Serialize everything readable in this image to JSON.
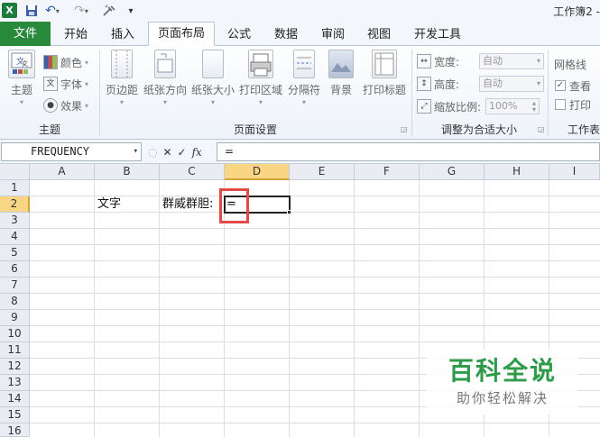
{
  "window": {
    "title": "工作簿2 -"
  },
  "qat": {
    "app_icon": "X",
    "save": "💾",
    "undo": "↶",
    "redo": "↷",
    "more": "▾"
  },
  "tabs": [
    {
      "label": "文件"
    },
    {
      "label": "开始"
    },
    {
      "label": "插入"
    },
    {
      "label": "页面布局"
    },
    {
      "label": "公式"
    },
    {
      "label": "数据"
    },
    {
      "label": "审阅"
    },
    {
      "label": "视图"
    },
    {
      "label": "开发工具"
    }
  ],
  "active_tab": "页面布局",
  "ribbon": {
    "theme_group": {
      "label": "主题",
      "themes_button": "主题",
      "colors": "颜色",
      "fonts": "字体",
      "effects": "效果"
    },
    "page_setup_group": {
      "label": "页面设置",
      "margins": "页边距",
      "orientation": "纸张方向",
      "size": "纸张大小",
      "print_area": "打印区域",
      "breaks": "分隔符",
      "background": "背景",
      "print_titles": "打印标题"
    },
    "scale_group": {
      "label": "调整为合适大小",
      "width_label": "宽度:",
      "width_value": "自动",
      "height_label": "高度:",
      "height_value": "自动",
      "scale_label": "缩放比例:",
      "scale_value": "100%"
    },
    "sheet_options_group": {
      "label": "工作表",
      "gridlines": "网格线",
      "view": "查看",
      "print": "打印"
    }
  },
  "formula_bar": {
    "name_box": "FREQUENCY",
    "fx": "fx",
    "content": "="
  },
  "sheet": {
    "columns": [
      "A",
      "B",
      "C",
      "D",
      "E",
      "F",
      "G",
      "H",
      "I"
    ],
    "rows": [
      "1",
      "2",
      "3",
      "4",
      "5",
      "6",
      "7",
      "8",
      "9",
      "10",
      "11",
      "12",
      "13",
      "14",
      "15",
      "16"
    ],
    "active_column": "D",
    "active_row": "2",
    "cells": {
      "B2": "文字",
      "C2": "群威群胆:",
      "D2": "="
    }
  },
  "watermark": {
    "title": "百科全说",
    "subtitle": "助你轻松解决"
  },
  "colors": {
    "file_tab": "#2a8a3c",
    "selection_header": "#f8d684",
    "highlight": "#e24a4a",
    "watermark": "#2e9a4a"
  }
}
